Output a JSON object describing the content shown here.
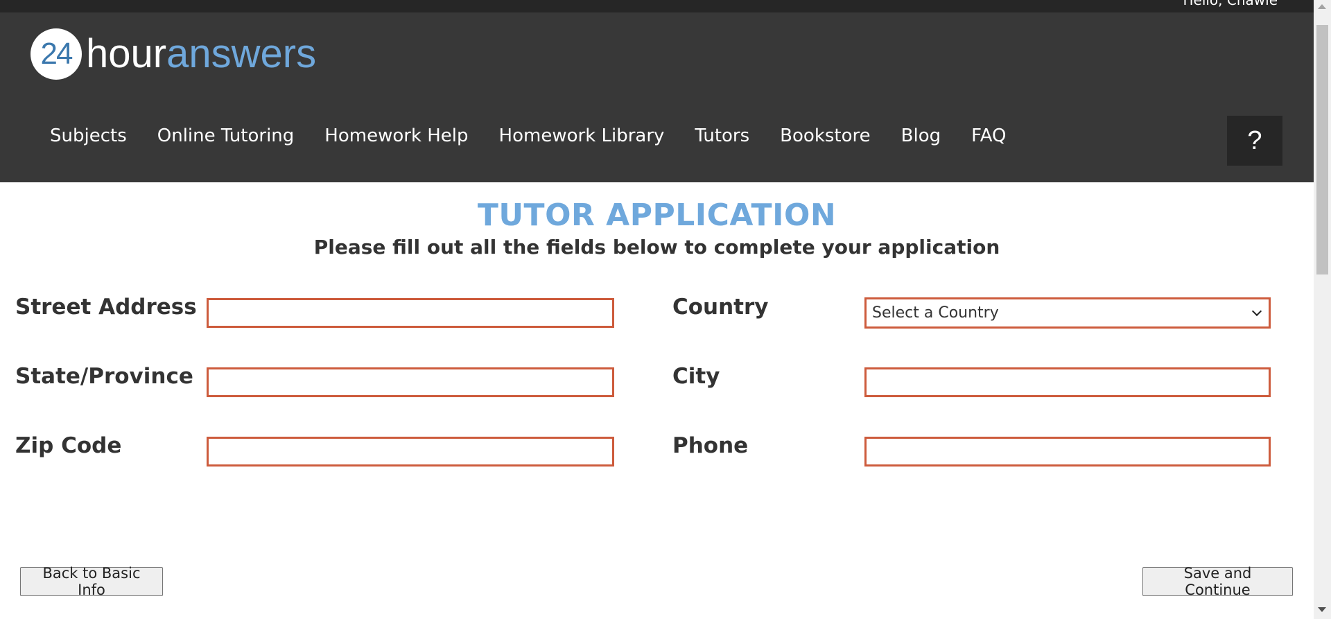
{
  "header": {
    "greeting": "Hello, Chawie",
    "logo": {
      "number": "24",
      "word_part1": "hour",
      "word_part2": "answers"
    },
    "nav": [
      {
        "label": "Subjects"
      },
      {
        "label": "Online Tutoring"
      },
      {
        "label": "Homework Help"
      },
      {
        "label": "Homework Library"
      },
      {
        "label": "Tutors"
      },
      {
        "label": "Bookstore"
      },
      {
        "label": "Blog"
      },
      {
        "label": "FAQ"
      }
    ],
    "help_label": "?"
  },
  "form": {
    "title": "TUTOR APPLICATION",
    "subtitle": "Please fill out all the fields below to complete your application",
    "street_address": {
      "label": "Street Address",
      "value": ""
    },
    "state_province": {
      "label": "State/Province",
      "value": ""
    },
    "zip_code": {
      "label": "Zip Code",
      "value": ""
    },
    "country": {
      "label": "Country",
      "selected": "Select a Country"
    },
    "city": {
      "label": "City",
      "value": ""
    },
    "phone": {
      "label": "Phone",
      "value": ""
    }
  },
  "actions": {
    "back_label": "Back to Basic Info",
    "save_label": "Save and Continue"
  },
  "colors": {
    "header_bg": "#383838",
    "topbar_bg": "#262626",
    "accent_blue": "#6fa8dc",
    "input_border": "#cd5b3c"
  }
}
